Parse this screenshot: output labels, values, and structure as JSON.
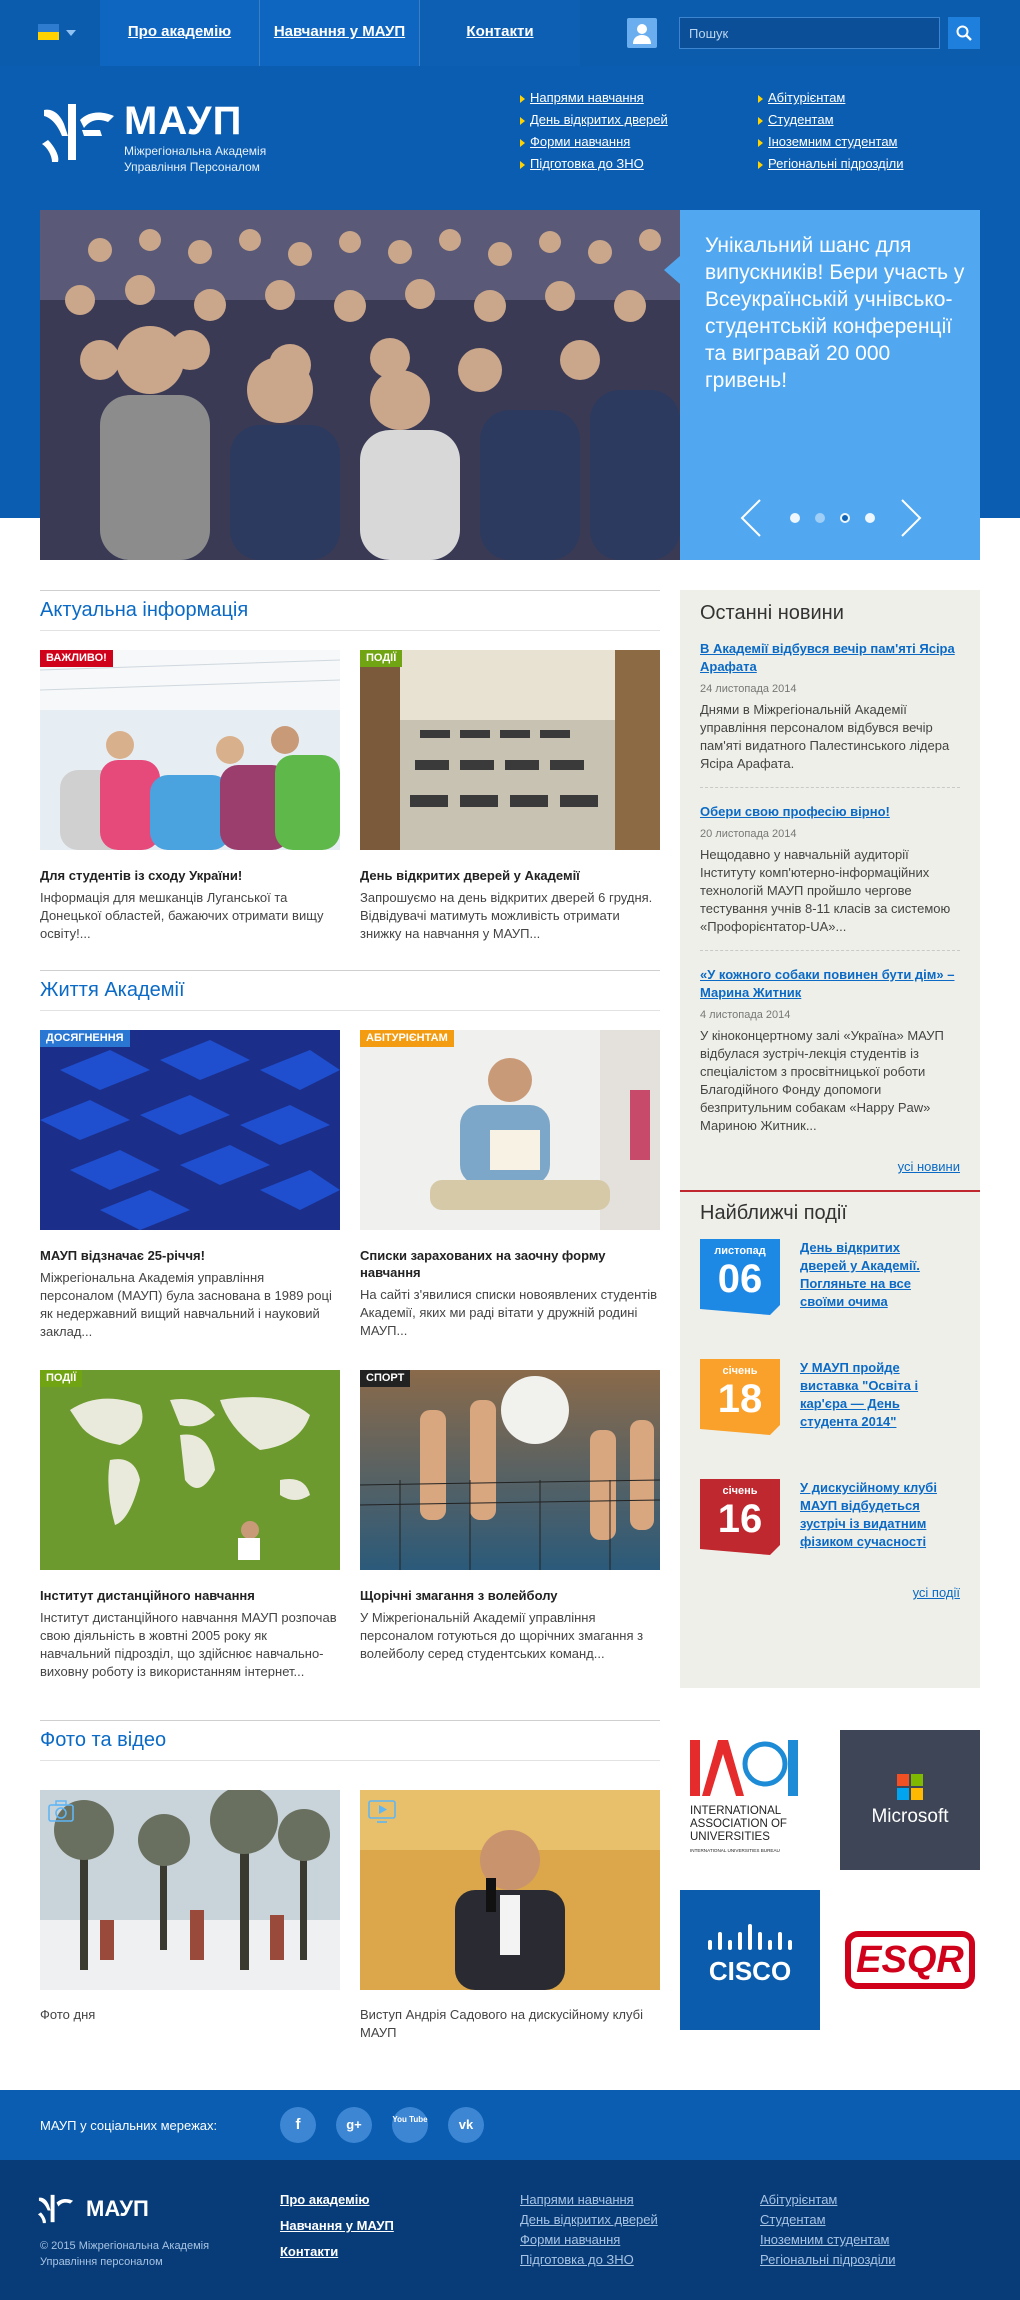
{
  "topbar": {
    "nav": [
      "Про академію",
      "Навчання у МАУП",
      "Контакти"
    ],
    "search_placeholder": "Пошук"
  },
  "header": {
    "logo_title": "МАУП",
    "logo_subtitle_1": "Міжрегіональна Академія",
    "logo_subtitle_2": "Управління Персоналом",
    "nav_col1": [
      "Напрями навчання",
      "День відкритих дверей",
      "Форми навчання",
      "Підготовка до ЗНО"
    ],
    "nav_col2": [
      "Абітурієнтам",
      "Студентам",
      "Іноземним студентам",
      "Регіональні підрозділи"
    ]
  },
  "slider": {
    "text": "Унікальний шанс для випускників! Бери участь у Всеукраїнській учнівсько-студентській конференції та вигравай 20 000 гривень!",
    "active_slide": 3,
    "slide_count": 4
  },
  "actual": {
    "title": "Актуальна інформація",
    "cards": [
      {
        "badge": "Важливо!",
        "title": "Для студентів із сходу України!",
        "text": "Інформація для мешканців Луганської та Донецької областей, бажаючих отримати вищу освіту!..."
      },
      {
        "badge": "Події",
        "title": "День відкритих дверей у Академії",
        "text": "Запрошуємо на день відкритих дверей 6 грудня. Відвідувачі матимуть можливість отримати знижку на навчання у МАУП..."
      }
    ]
  },
  "life": {
    "title": "Життя Академії",
    "cards": [
      {
        "badge": "Досягнення",
        "title": "МАУП відзначає 25-річчя!",
        "text": "Міжрегіональна Академія управління персоналом (МАУП) була заснована в 1989 році як недержавний вищий навчальний і науковий заклад..."
      },
      {
        "badge": "Абітурієнтам",
        "title": "Списки зарахованих на заочну форму навчання",
        "text": "На сайті з'явилися списки новоявлених студентів Академії, яких ми раді вітати у дружній родині МАУП..."
      },
      {
        "badge": "Події",
        "title": "Інститут дистанційного навчання",
        "text": "Інститут дистанційного навчання МАУП розпочав свою діяльність в жовтні 2005 року як навчальний підрозділ, що здійснює навчально-виховну роботу із використанням інтернет..."
      },
      {
        "badge": "Спорт",
        "title": "Щорічні змагання з волейболу",
        "text": "У Міжрегіональній  Академії управління персоналом готуються до щорічних змагання з волейболу серед студентських команд..."
      }
    ]
  },
  "media": {
    "title": "Фото та відео",
    "cards": [
      {
        "caption": "Фото дня"
      },
      {
        "caption": "Виступ Андрія Садового на дискусійному клубі МАУП"
      }
    ]
  },
  "news": {
    "title": "Останні новини",
    "items": [
      {
        "title": "В Академії відбувся вечір пам'яті Ясіра Арафата",
        "date": "24 листопада 2014",
        "text": "Днями в Міжрегіональній Академії управління персоналом відбувся вечір пам'яті видатного Палестинського лідера Ясіра Арафата."
      },
      {
        "title": "Обери свою професію вірно!",
        "date": "20 листопада 2014",
        "text": "Нещодавно у навчальній аудиторії Інституту комп'ютерно-інформаційних технологій МАУП пройшло чергове тестування учнів 8-11 класів за системою «Профорієнтатор-UA»..."
      },
      {
        "title": "«У кожного собаки повинен бути дім» – Марина Житник",
        "date": "4 листопада 2014",
        "text": "У кіноконцертному залі «Україна» МАУП відбулася зустріч-лекція студентів із спеціалістом з просвітницької роботи Благодійного Фонду допомоги безпритульним собакам «Happy Paw» Мариною Житник..."
      }
    ],
    "all_label": "усі новини"
  },
  "events": {
    "title": "Найближчі події",
    "items": [
      {
        "month": "листопад",
        "day": "06",
        "title": "День відкритих дверей у Академії. Погляньте на все своїми очима",
        "color": "#1e88e5"
      },
      {
        "month": "січень",
        "day": "18",
        "title": "У МАУП пройде виставка \"Освіта і кар'єра — День студента 2014\"",
        "color": "#f9a12b"
      },
      {
        "month": "січень",
        "day": "16",
        "title": "У дискусійному клубі МАУП відбудеться зустріч із видатним фізиком сучасності",
        "color": "#d0021b"
      }
    ],
    "all_label": "усі події"
  },
  "partners": {
    "iau_line1": "INTERNATIONAL",
    "iau_line2": "ASSOCIATION OF",
    "iau_line3": "UNIVERSITIES",
    "iau_line4": "INTERNATIONAL UNIVERSITIES BUREAU",
    "microsoft": "Microsoft",
    "cisco": "CISCO",
    "esqr": "ESQR"
  },
  "social": {
    "label": "МАУП у соціальних мережах:",
    "icons": [
      "f",
      "g+",
      "You Tube",
      "vk"
    ]
  },
  "footer": {
    "logo": "МАУП",
    "copyright": "© 2015 Міжрегіональна Академія Управління персоналом",
    "col1": [
      "Про академію",
      "Навчання у МАУП",
      "Контакти"
    ],
    "col2": [
      "Напрями навчання",
      "День відкритих дверей",
      "Форми навчання",
      "Підготовка до ЗНО"
    ],
    "col3": [
      "Абітурієнтам",
      "Студентам",
      "Іноземним студентам",
      "Регіональні підрозділи"
    ]
  }
}
